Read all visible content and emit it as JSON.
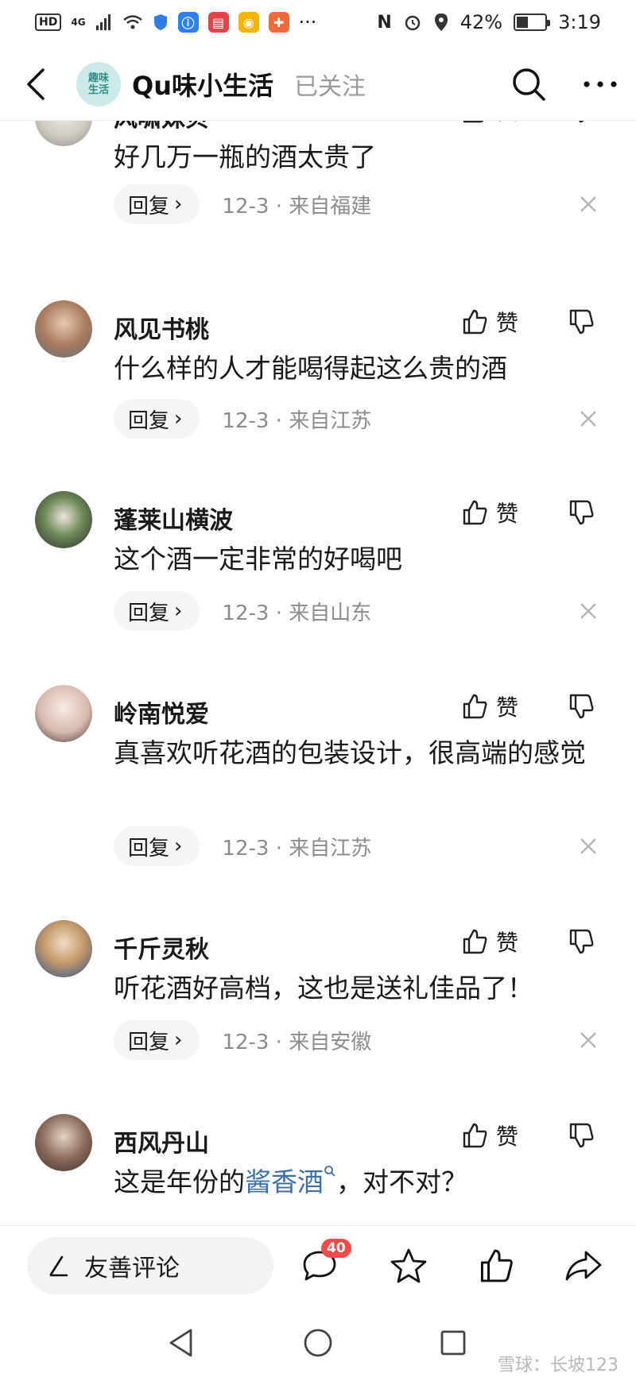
{
  "status_bar": {
    "hd": "HD",
    "network": "4G",
    "battery_text": "42%",
    "battery_level": 0.42,
    "time": "3:19",
    "more": "···"
  },
  "header": {
    "title": "Qu味小生活",
    "logo_text": "趣味生活",
    "follow_status": "已关注"
  },
  "comments": [
    {
      "name": "风啸姝贝",
      "text": "好几万一瓶的酒太贵了",
      "reply": "回复",
      "date": "12-3 · 来自福建",
      "like": "赞"
    },
    {
      "name": "风见书桃",
      "text": "什么样的人才能喝得起这么贵的酒",
      "reply": "回复",
      "date": "12-3 · 来自江苏",
      "like": "赞"
    },
    {
      "name": "蓬莱山横波",
      "text": "这个酒一定非常的好喝吧",
      "reply": "回复",
      "date": "12-3 · 来自山东",
      "like": "赞"
    },
    {
      "name": "岭南悦爱",
      "text": "真喜欢听花酒的包装设计，很高端的感觉",
      "reply": "回复",
      "date": "12-3 · 来自江苏",
      "like": "赞"
    },
    {
      "name": "千斤灵秋",
      "text": "听花酒好高档，这也是送礼佳品了！",
      "reply": "回复",
      "date": "12-3 · 来自安徽",
      "like": "赞"
    },
    {
      "name": "西风丹山",
      "text_before": "这是年份的",
      "text_link": "酱香酒",
      "text_after": "，对不对？",
      "like": "赞"
    }
  ],
  "bottom_bar": {
    "input_placeholder": "友善评论",
    "comment_count": "40"
  },
  "watermark": "雪球：长坡123",
  "colors": {
    "link": "#3d6fa8",
    "badge": "#f04b4b",
    "meta": "#8c8c8c"
  }
}
